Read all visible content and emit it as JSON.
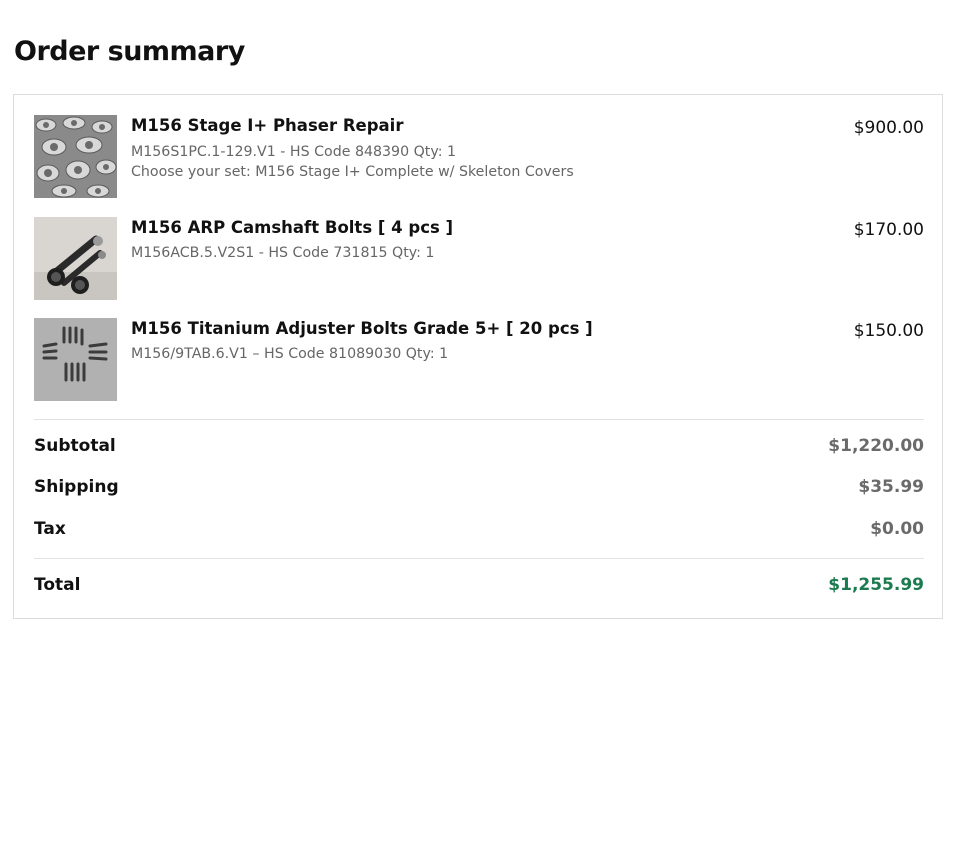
{
  "page_title": "Order summary",
  "items": [
    {
      "name": "M156 Stage I+ Phaser Repair",
      "meta1": "M156S1PC.1-129.V1 - HS Code 848390 Qty: 1",
      "meta2": "Choose your set: M156 Stage I+ Complete w/ Skeleton Covers",
      "price": "$900.00",
      "image": "phaser-plates-photo"
    },
    {
      "name": "M156 ARP Camshaft Bolts [ 4 pcs ]",
      "meta1": "M156ACB.5.V2S1 - HS Code 731815 Qty: 1",
      "price": "$170.00",
      "image": "camshaft-bolts-photo"
    },
    {
      "name": "M156 Titanium Adjuster Bolts Grade 5+ [ 20 pcs ]",
      "meta1": "M156/9TAB.6.V1 – HS Code 81089030 Qty: 1",
      "price": "$150.00",
      "image": "titanium-bolts-photo"
    }
  ],
  "summary": {
    "subtotal_label": "Subtotal",
    "subtotal_value": "$1,220.00",
    "shipping_label": "Shipping",
    "shipping_value": "$35.99",
    "tax_label": "Tax",
    "tax_value": "$0.00",
    "total_label": "Total",
    "total_value": "$1,255.99"
  },
  "colors": {
    "total_accent": "#1c7a4f",
    "muted_text": "#666666",
    "border": "#dcdcdc"
  }
}
